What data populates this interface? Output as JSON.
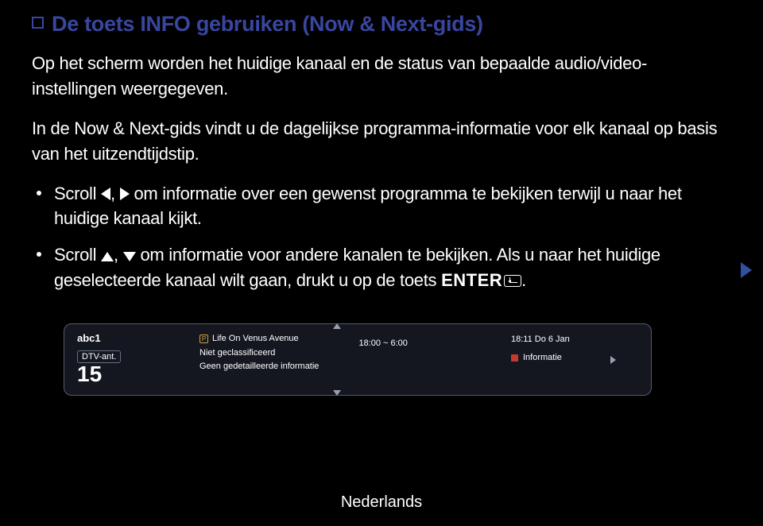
{
  "title": "De toets INFO gebruiken (Now & Next-gids)",
  "intro1": "Op het scherm worden het huidige kanaal en de status van bepaalde audio/video-instellingen weergegeven.",
  "intro2": "In de Now & Next-gids vindt u de dagelijkse programma-informatie voor elk kanaal op basis van het uitzendtijdstip.",
  "bullet1_a": "Scroll ",
  "bullet1_b": ", ",
  "bullet1_c": " om informatie over een gewenst programma te bekijken terwijl u naar het huidige kanaal kijkt.",
  "bullet2_a": "Scroll ",
  "bullet2_b": ", ",
  "bullet2_c": " om informatie voor andere kanalen te bekijken. Als u naar het huidige geselecteerde kanaal wilt gaan, drukt u op de toets ",
  "bullet2_enter": "ENTER",
  "bullet2_period": ".",
  "osd": {
    "channel_name": "abc1",
    "dtv_label": "DTV-ant.",
    "channel_num": "15",
    "program_title": "Life On Venus Avenue",
    "rating": "Niet geclassificeerd",
    "no_detail": "Geen gedetailleerde informatie",
    "time_range": "18:00 ~ 6:00",
    "clock": "18:11 Do 6 Jan",
    "info_label": "Informatie"
  },
  "footer": "Nederlands"
}
